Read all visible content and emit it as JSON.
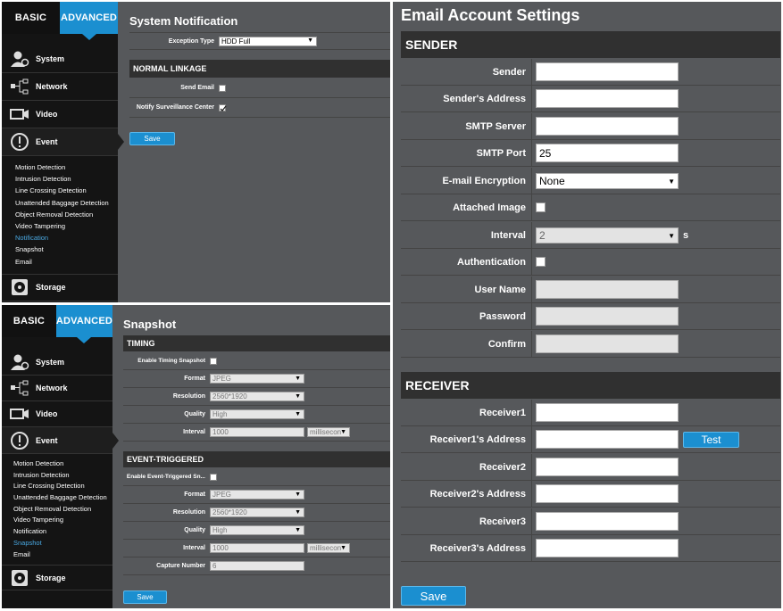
{
  "panel1": {
    "tabs": {
      "basic": "BASIC",
      "advanced": "ADVANCED"
    },
    "nav": {
      "system": "System",
      "network": "Network",
      "video": "Video",
      "event": "Event",
      "storage": "Storage"
    },
    "subitems": [
      "Motion Detection",
      "Intrusion Detection",
      "Line Crossing Detection",
      "Unattended Baggage Detection",
      "Object Removal Detection",
      "Video Tampering",
      "Notification",
      "Snapshot",
      "Email"
    ],
    "title": "System Notification",
    "exception_label": "Exception Type",
    "exception_value": "HDD Full",
    "section": "NORMAL LINKAGE",
    "send_email": "Send Email",
    "notify": "Notify Surveillance Center",
    "save": "Save"
  },
  "panel2": {
    "tabs": {
      "basic": "BASIC",
      "advanced": "ADVANCED"
    },
    "nav": {
      "system": "System",
      "network": "Network",
      "video": "Video",
      "event": "Event",
      "storage": "Storage"
    },
    "subitems": [
      "Motion Detection",
      "Intrusion Detection",
      "Line Crossing Detection",
      "Unattended Baggage Detection",
      "Object Removal Detection",
      "Video Tampering",
      "Notification",
      "Snapshot",
      "Email"
    ],
    "title": "Snapshot",
    "timing": "TIMING",
    "enable_timing": "Enable Timing Snapshot",
    "format_label": "Format",
    "format": "JPEG",
    "resolution_label": "Resolution",
    "resolution": "2560*1920",
    "quality_label": "Quality",
    "quality": "High",
    "interval_label": "Interval",
    "interval": "1000",
    "unit": "millisecon",
    "event_section": "EVENT-TRIGGERED",
    "enable_event": "Enable Event-Triggered Sn...",
    "capture_label": "Capture Number",
    "capture": "6",
    "save": "Save"
  },
  "email": {
    "title": "Email Account Settings",
    "sender_section": "SENDER",
    "sender": "Sender",
    "sender_address": "Sender's Address",
    "smtp_server": "SMTP Server",
    "smtp_port": "SMTP Port",
    "smtp_port_value": "25",
    "encryption": "E-mail Encryption",
    "encryption_value": "None",
    "attached": "Attached Image",
    "interval": "Interval",
    "interval_value": "2",
    "interval_unit": "s",
    "auth": "Authentication",
    "username": "User Name",
    "password": "Password",
    "confirm": "Confirm",
    "receiver_section": "RECEIVER",
    "r1": "Receiver1",
    "r1a": "Receiver1's Address",
    "test": "Test",
    "r2": "Receiver2",
    "r2a": "Receiver2's Address",
    "r3": "Receiver3",
    "r3a": "Receiver3's Address",
    "save": "Save"
  }
}
